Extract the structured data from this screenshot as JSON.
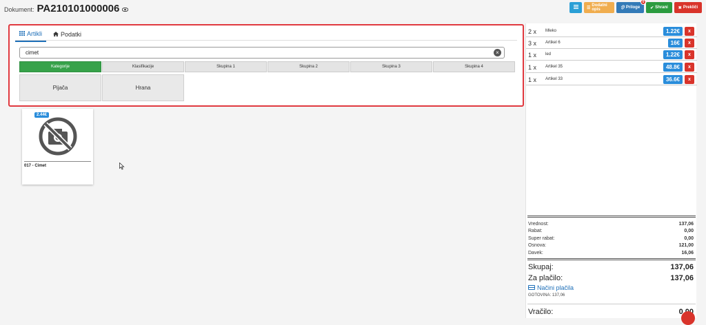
{
  "header": {
    "label": "Dokument:",
    "document_number": "PA210101000006",
    "eye_icon": "eye-icon"
  },
  "toolbar": {
    "list_icon": "list-icon",
    "extra_label": "Dodatni opis",
    "attach_label": "Priloge",
    "attach_badge": "0",
    "save_label": "Shrani",
    "cancel_label": "Prekliči"
  },
  "tabs": [
    {
      "label": "Artikli",
      "icon": "grid-icon",
      "active": true
    },
    {
      "label": "Podatki",
      "icon": "home-icon",
      "active": false
    }
  ],
  "search": {
    "value": "cimet",
    "placeholder": ""
  },
  "category_tabs": [
    {
      "label": "Kategorije",
      "active": true
    },
    {
      "label": "Klasifikacije",
      "active": false
    },
    {
      "label": "Skupina 1",
      "active": false
    },
    {
      "label": "Skupina 2",
      "active": false
    },
    {
      "label": "Skupina 3",
      "active": false
    },
    {
      "label": "Skupina 4",
      "active": false
    }
  ],
  "groups": [
    "Pijača",
    "Hrana"
  ],
  "products": [
    {
      "name": "017 - Cimet",
      "price": "2.44€",
      "image": "no-photo-icon"
    }
  ],
  "cart": [
    {
      "qty": "2 x",
      "name": "Mleko",
      "price": "1.22€"
    },
    {
      "qty": "3 x",
      "name": "Artikel 6",
      "price": "16€"
    },
    {
      "qty": "1 x",
      "name": "led",
      "price": "1.22€"
    },
    {
      "qty": "1 x",
      "name": "Artikel 35",
      "price": "48.8€"
    },
    {
      "qty": "1 x",
      "name": "Artikel 33",
      "price": "36.6€"
    }
  ],
  "totals": {
    "rows": [
      {
        "label": "Vrednost:",
        "value": "137,06"
      },
      {
        "label": "Rabat:",
        "value": "0,00"
      },
      {
        "label": "Super rabat:",
        "value": "0,00"
      },
      {
        "label": "Osnova:",
        "value": "121,00"
      },
      {
        "label": "Davek:",
        "value": "16,06"
      }
    ],
    "skupaj_label": "Skupaj:",
    "skupaj_value": "137,06",
    "zaplacilo_label": "Za plačilo:",
    "zaplacilo_value": "137,06",
    "payment_methods_label": "Načini plačila",
    "cash_line": "GOTOVINA: 137,06",
    "vracilo_label": "Vračilo:",
    "vracilo_value": "0,00"
  }
}
